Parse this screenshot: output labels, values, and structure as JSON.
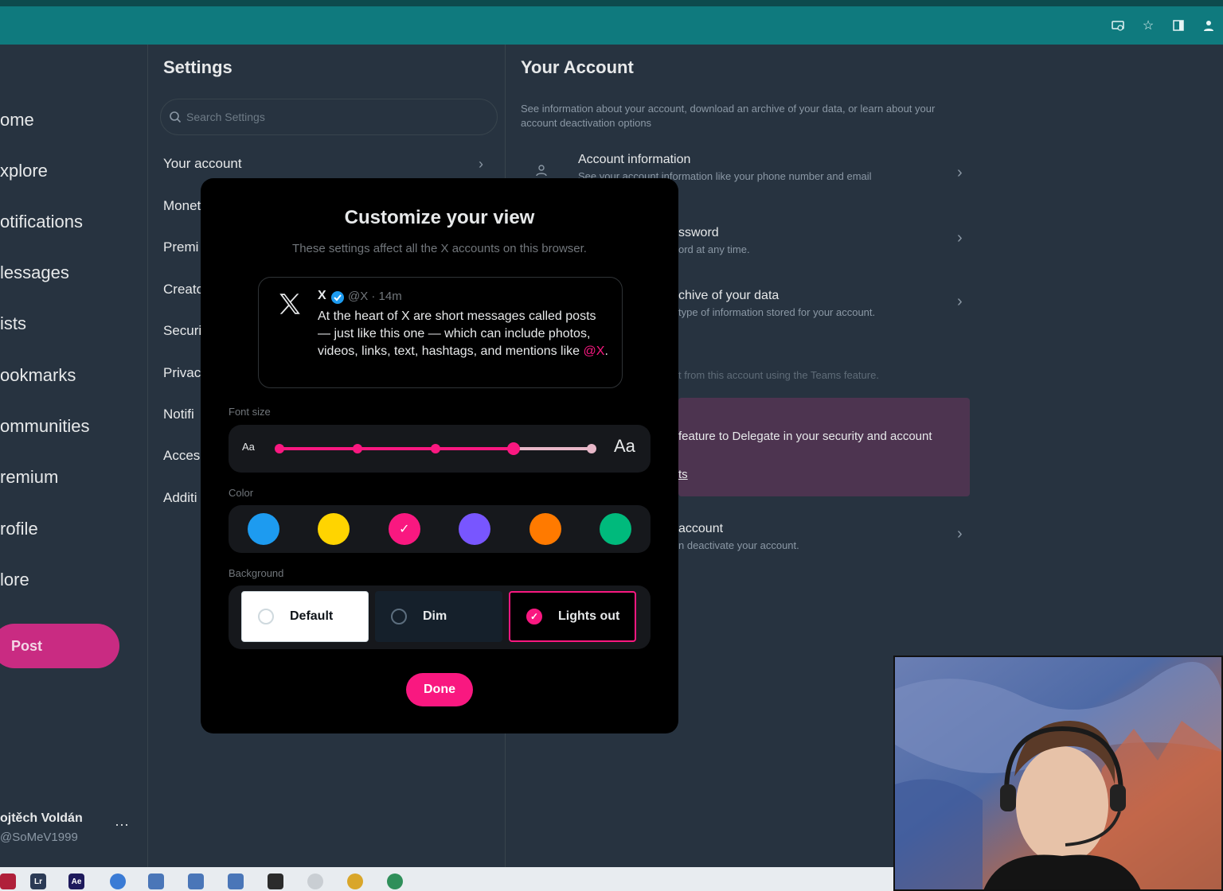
{
  "nav": {
    "items": [
      "ome",
      "xplore",
      "otifications",
      "lessages",
      "ists",
      "ookmarks",
      "ommunities",
      "remium",
      "rofile",
      "lore"
    ],
    "post_label": "Post",
    "user_name": "ojtěch Voldán",
    "user_handle": "@SoMeV1999",
    "more_label": "···"
  },
  "settings": {
    "title": "Settings",
    "search_placeholder": "Search Settings",
    "items": [
      "Your account",
      "Monet",
      "Premi",
      "Creato",
      "Securi",
      "Privac",
      "Notifi",
      "Acces",
      "Additi"
    ]
  },
  "account": {
    "title": "Your Account",
    "description": "See information about your account, download an archive of your data, or learn about your account deactivation options",
    "rows": [
      {
        "title": "Account information",
        "sub": "See your account information like your phone number and email"
      },
      {
        "title": "ssword",
        "sub": "ord at any time."
      },
      {
        "title": "chive of your data",
        "sub": "type of information stored for your account."
      },
      {
        "title": "",
        "sub": "t from this account using the Teams feature."
      },
      {
        "title": "account",
        "sub": "n deactivate your account."
      }
    ],
    "delegate_text": "feature to Delegate in your security and account",
    "delegate_link": "ts"
  },
  "modal": {
    "title": "Customize your view",
    "subtitle": "These settings affect all the X accounts on this browser.",
    "preview": {
      "name": "X",
      "meta": "@X · 14m",
      "text": "At the heart of X are short messages called posts — just like this one — which can include photos, videos, links, text, hashtags, and mentions like ",
      "mention": "@X",
      "end": "."
    },
    "font_size_label": "Font size",
    "font_small": "Aa",
    "font_large": "Aa",
    "font_size_level": 4,
    "font_size_steps": 5,
    "color_label": "Color",
    "colors": [
      "#1d9bf0",
      "#ffd400",
      "#f91880",
      "#7856ff",
      "#ff7a00",
      "#00ba7c"
    ],
    "selected_color": 2,
    "background_label": "Background",
    "bg_default": "Default",
    "bg_dim": "Dim",
    "bg_lights_out": "Lights out",
    "done_label": "Done"
  },
  "colors": {
    "accent": "#f91880",
    "page_bg": "#273340",
    "browser": "#0f7a7e"
  }
}
